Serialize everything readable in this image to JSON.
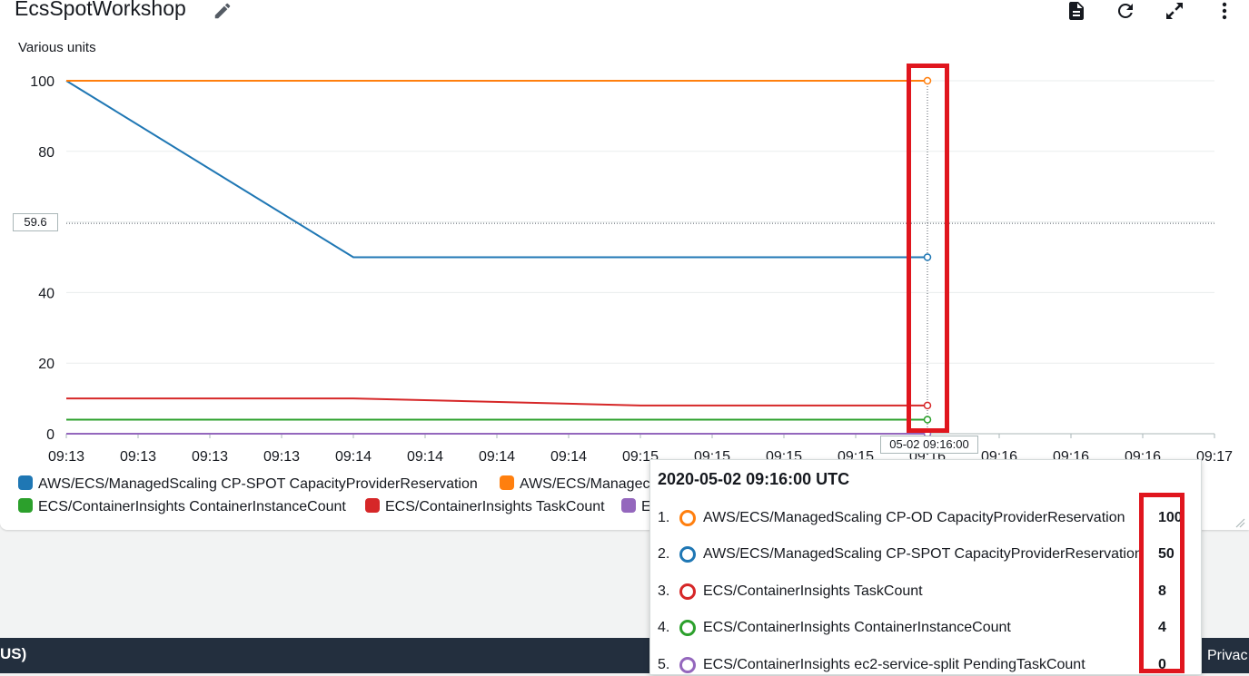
{
  "widget": {
    "title": "EcsSpotWorkshop",
    "y_unit": "Various units",
    "crosshair_value": "59.6",
    "x_hover_time": "05-02 09:16:00"
  },
  "toolbar": {
    "icons": [
      "edit-icon",
      "document-icon",
      "refresh-icon",
      "expand-icon",
      "more-vertical-icon"
    ]
  },
  "chart_data": {
    "type": "line",
    "x_tick_labels": [
      "09:13",
      "09:13",
      "09:13",
      "09:13",
      "09:14",
      "09:14",
      "09:14",
      "09:14",
      "09:15",
      "09:15",
      "09:15",
      "09:15",
      "09:16",
      "09:16",
      "09:16",
      "09:16",
      "09:17"
    ],
    "x": [
      "09:13:00",
      "09:14:00",
      "09:15:00",
      "09:16:00"
    ],
    "ylim": [
      0,
      100
    ],
    "yticks": [
      0,
      20,
      40,
      60,
      80,
      100
    ],
    "grid": true,
    "series": [
      {
        "name": "AWS/ECS/ManagedScaling CP-SPOT CapacityProviderReservation",
        "color": "#1f77b4",
        "values": [
          100,
          50,
          50,
          50
        ]
      },
      {
        "name": "AWS/ECS/ManagedScaling CP-OD CapacityProviderReservation",
        "color": "#ff7f0e",
        "values": [
          100,
          100,
          100,
          100
        ]
      },
      {
        "name": "ECS/ContainerInsights ContainerInstanceCount",
        "color": "#2ca02c",
        "values": [
          4,
          4,
          4,
          4
        ]
      },
      {
        "name": "ECS/ContainerInsights TaskCount",
        "color": "#d62728",
        "values": [
          10,
          10,
          8,
          8
        ]
      },
      {
        "name": "ECS/ContainerInsights ec2-service-split PendingTaskCount",
        "color": "#9467bd",
        "values": [
          0,
          0,
          0,
          0
        ]
      }
    ]
  },
  "legend": {
    "row1": [
      {
        "label": "AWS/ECS/ManagedScaling CP-SPOT CapacityProviderReservation",
        "color": "#1f77b4"
      },
      {
        "label": "AWS/ECS/Managec",
        "color": "#ff7f0e"
      }
    ],
    "row2": [
      {
        "label": "ECS/ContainerInsights ContainerInstanceCount",
        "color": "#2ca02c"
      },
      {
        "label": "ECS/ContainerInsights TaskCount",
        "color": "#d62728"
      },
      {
        "label": "E",
        "color": "#9467bd"
      }
    ]
  },
  "tooltip": {
    "title": "2020-05-02 09:16:00 UTC",
    "rows": [
      {
        "num": "1.",
        "label": "AWS/ECS/ManagedScaling CP-OD CapacityProviderReservation",
        "value": "100",
        "color": "#ff7f0e"
      },
      {
        "num": "2.",
        "label": "AWS/ECS/ManagedScaling CP-SPOT CapacityProviderReservation",
        "value": "50",
        "color": "#1f77b4"
      },
      {
        "num": "3.",
        "label": "ECS/ContainerInsights TaskCount",
        "value": "8",
        "color": "#d62728"
      },
      {
        "num": "4.",
        "label": "ECS/ContainerInsights ContainerInstanceCount",
        "value": "4",
        "color": "#2ca02c"
      },
      {
        "num": "5.",
        "label": "ECS/ContainerInsights ec2-service-split PendingTaskCount",
        "value": "0",
        "color": "#9467bd"
      }
    ]
  },
  "footer": {
    "region_fragment": "US)",
    "privacy_fragment": "Privac"
  }
}
